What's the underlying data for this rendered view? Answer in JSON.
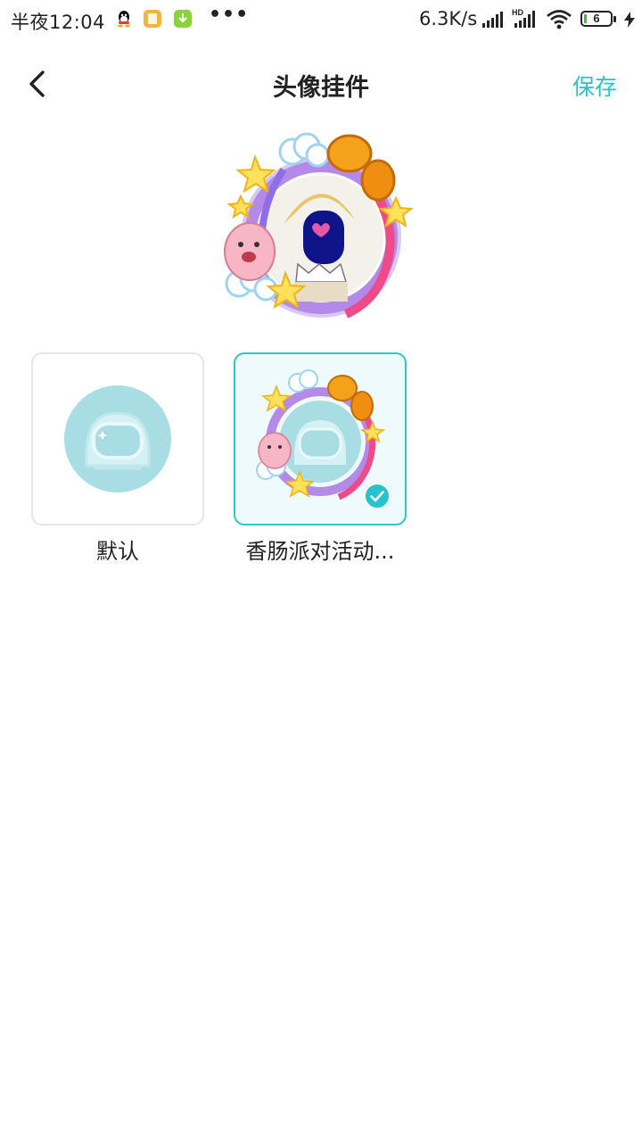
{
  "status_bar": {
    "time": "半夜12:04",
    "more": "•••",
    "net_speed": "6.3K/s",
    "hd_label": "HD",
    "battery_level": "6",
    "icons": [
      "qq-icon",
      "notes-app-icon",
      "download-app-icon",
      "signal-icon",
      "hd-signal-icon",
      "wifi-icon",
      "battery-icon",
      "charging-icon"
    ]
  },
  "header": {
    "title": "头像挂件",
    "save_label": "保存",
    "back_icon": "chevron-left-icon"
  },
  "colors": {
    "accent": "#27c3cc",
    "selected_border": "#2fc5ca",
    "selected_bg": "#eefafb",
    "default_border": "#e6e6e6"
  },
  "pendants": [
    {
      "label": "默认",
      "selected": false
    },
    {
      "label": "香肠派对活动...",
      "selected": true
    }
  ]
}
